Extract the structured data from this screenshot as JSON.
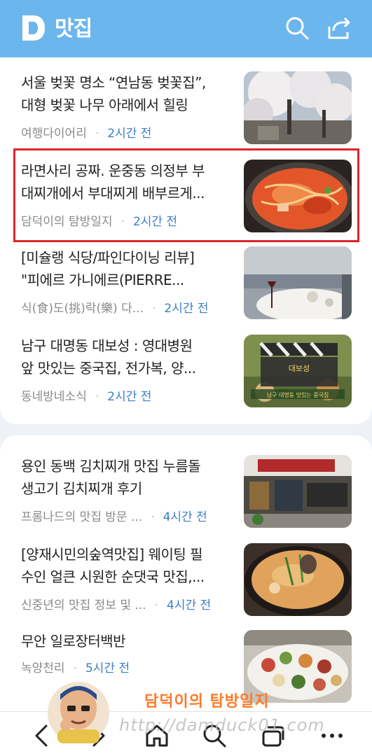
{
  "header": {
    "logo_letter": "D",
    "title": "맛집",
    "colors": {
      "bar": "#6cb6ee",
      "text": "#ffffff"
    }
  },
  "articles": [
    {
      "title_line1": "서울 벚꽃 명소 “연남동 벚꽃집”,",
      "title_line2": "대형 벚꽃 나무 아래에서 힐링",
      "source": "여행다이어리",
      "time": "2시간 전",
      "thumb": "cherry-blossom-trees"
    },
    {
      "title_line1": "라면사리 공짜. 운중동 의정부 부",
      "title_line2": "대찌개에서 부대찌게 배부르게...",
      "source": "담덕이의 탐방일지",
      "time": "2시간 전",
      "thumb": "budae-jjigae-pot",
      "highlighted": true
    },
    {
      "title_line1": "[미슐랭 식당/파인다이닝 리뷰]",
      "title_line2": "\"피에르 가니에르(PIERRE...",
      "source": "식(食)도(挑)락(樂) 다...",
      "time": "2시간 전",
      "thumb": "fine-dining-table"
    },
    {
      "title_line1": "남구 대명동 대보성 : 영대병원",
      "title_line2": "앞 맛있는 중국집, 전가복, 양...",
      "source": "동네방네소식",
      "time": "2시간 전",
      "thumb": "video-clapper-thumbnail"
    },
    {
      "title_line1": "용인 동백 김치찌개 맛집 누름돌",
      "title_line2": "생고기 김치찌개 후기",
      "source": "프롬나드의 맛집 방문 ...",
      "time": "4시간 전",
      "thumb": "restaurant-storefront"
    },
    {
      "title_line1": "[양재시민의숲역맛집] 웨이팅 필",
      "title_line2": "수인 얼큰 시원한 순댓국 맛집,...",
      "source": "신중년의 맛집 정보 및 ...",
      "time": "4시간 전",
      "thumb": "sundaeguk-bowl"
    },
    {
      "title_line1": "무안 일로장터백반",
      "title_line2": "",
      "source": "녹양천리",
      "time": "5시간 전",
      "thumb": "banchan-spread"
    }
  ],
  "thumbnail_text": {
    "video_title": "대보성",
    "video_subtitle": "남구 대명동 맛있는 중국집"
  },
  "bottom_nav": {
    "items": [
      "back-icon",
      "forward-icon",
      "home-icon",
      "search-icon",
      "tabs-icon",
      "more-icon"
    ]
  },
  "watermark": {
    "name": "담덕이의 탐방일지",
    "url": "http://damduck01.com"
  },
  "colors": {
    "accent_time": "#3d7dc8",
    "highlight_border": "#e0242b",
    "watermark": "#ff7a28"
  }
}
